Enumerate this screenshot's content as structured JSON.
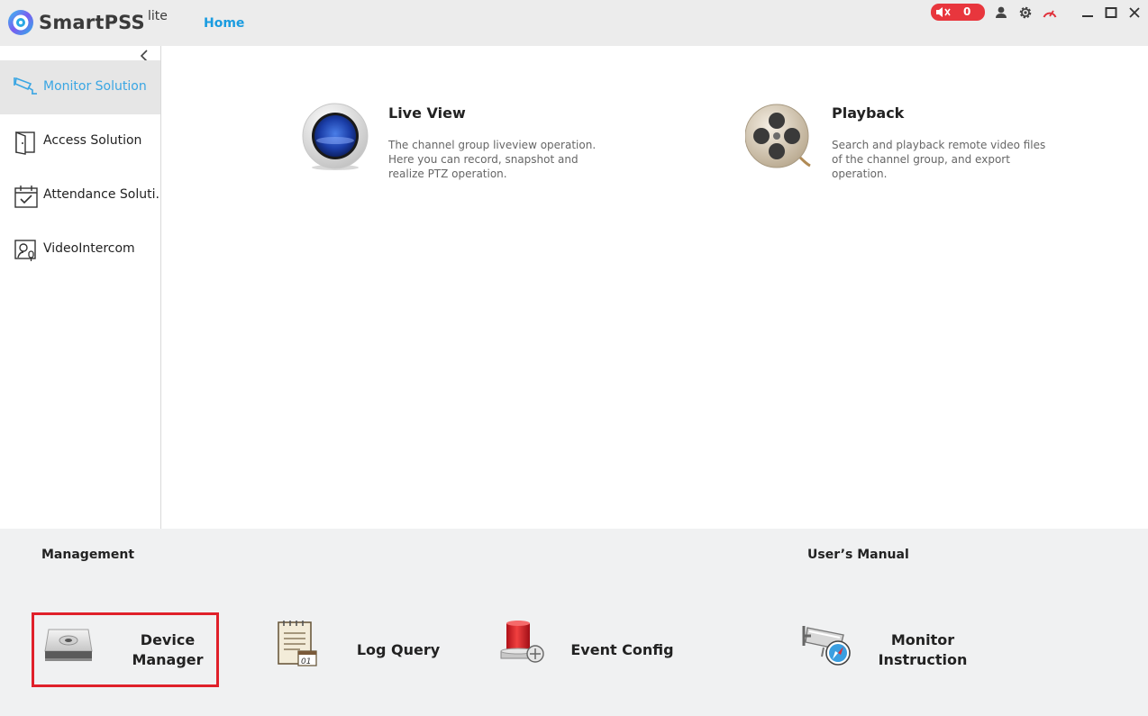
{
  "app": {
    "name": "SmartPSS",
    "edition": "lite"
  },
  "nav": {
    "home": "Home"
  },
  "toolbar": {
    "alarm_count": "0"
  },
  "sidebar": {
    "items": [
      {
        "label": "Monitor Solution",
        "active": true
      },
      {
        "label": "Access Solution"
      },
      {
        "label": "Attendance Soluti..."
      },
      {
        "label": "VideoIntercom"
      }
    ]
  },
  "main": {
    "cards": [
      {
        "title": "Live View",
        "desc": "The channel group liveview operation. Here you can record, snapshot and realize PTZ operation."
      },
      {
        "title": "Playback",
        "desc": "Search and playback remote video files of the channel group, and export operation."
      }
    ]
  },
  "bottom": {
    "management_title": "Management",
    "manual_title": "User’s Manual",
    "tools": [
      {
        "label": "Device Manager",
        "highlighted": true
      },
      {
        "label": "Log Query"
      },
      {
        "label": "Event Config"
      },
      {
        "label": "Monitor Instruction"
      }
    ]
  },
  "colors": {
    "accent": "#1a9ce0",
    "alarm": "#e8363d",
    "highlight": "#e0202a"
  }
}
